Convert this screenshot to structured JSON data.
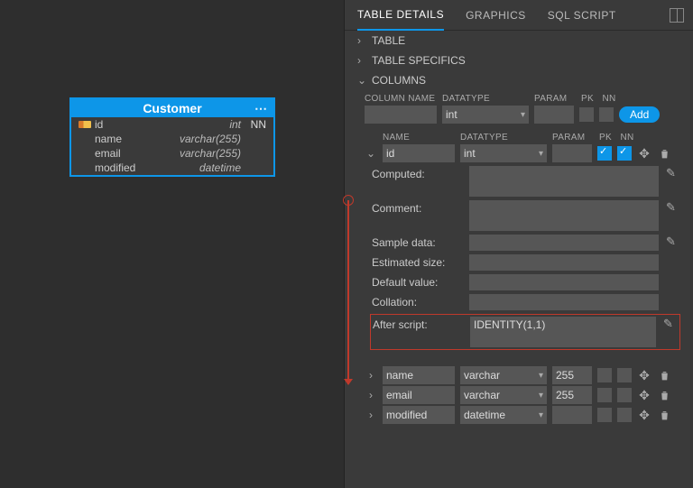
{
  "entity": {
    "title": "Customer",
    "rows": [
      {
        "name": "id",
        "type": "int",
        "nn": "NN",
        "pk": true
      },
      {
        "name": "name",
        "type": "varchar(255)",
        "nn": "",
        "pk": false
      },
      {
        "name": "email",
        "type": "varchar(255)",
        "nn": "",
        "pk": false
      },
      {
        "name": "modified",
        "type": "datetime",
        "nn": "",
        "pk": false
      }
    ]
  },
  "tabs": {
    "details": "TABLE DETAILS",
    "graphics": "GRAPHICS",
    "sql": "SQL SCRIPT"
  },
  "sections": {
    "table": "TABLE",
    "specifics": "TABLE SPECIFICS",
    "columns": "COLUMNS"
  },
  "headers": {
    "colname": "COLUMN NAME",
    "datatype": "DATATYPE",
    "param": "PARAM",
    "pk": "PK",
    "nn": "NN",
    "name": "NAME"
  },
  "newcol": {
    "datatype": "int"
  },
  "add_label": "Add",
  "expanded_col": {
    "name": "id",
    "datatype": "int",
    "param": "",
    "pk": true,
    "nn": true
  },
  "details": {
    "computed_lbl": "Computed:",
    "comment_lbl": "Comment:",
    "sample_lbl": "Sample data:",
    "estsize_lbl": "Estimated size:",
    "default_lbl": "Default value:",
    "collation_lbl": "Collation:",
    "afterscript_lbl": "After script:",
    "afterscript_val": "IDENTITY(1,1)"
  },
  "other_cols": [
    {
      "name": "name",
      "datatype": "varchar",
      "param": "255"
    },
    {
      "name": "email",
      "datatype": "varchar",
      "param": "255"
    },
    {
      "name": "modified",
      "datatype": "datetime",
      "param": ""
    }
  ]
}
